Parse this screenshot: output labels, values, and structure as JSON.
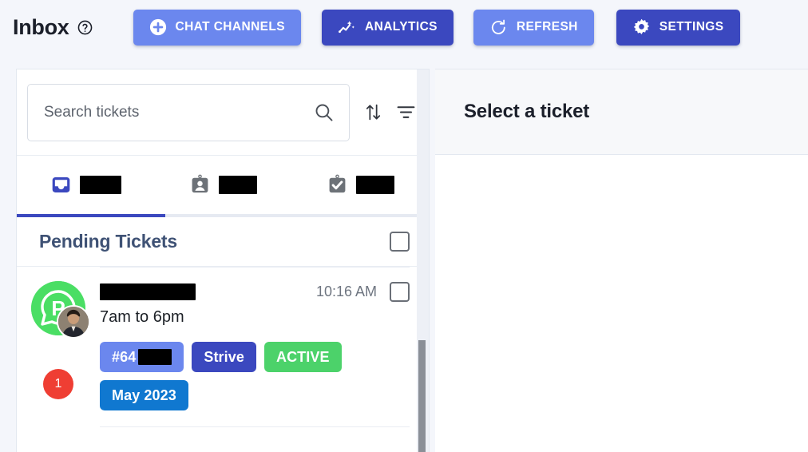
{
  "header": {
    "title": "Inbox",
    "help_icon": "help-circle-icon",
    "buttons": [
      {
        "id": "chat-channels",
        "label": "CHAT CHANNELS",
        "icon": "plus-circle-icon",
        "style": "light",
        "color": "#6b87ee"
      },
      {
        "id": "analytics",
        "label": "ANALYTICS",
        "icon": "analytics-sparkline-icon",
        "style": "dark",
        "color": "#3b48bf"
      },
      {
        "id": "refresh",
        "label": "REFRESH",
        "icon": "refresh-icon",
        "style": "light",
        "color": "#6b87ee"
      },
      {
        "id": "settings",
        "label": "SETTINGS",
        "icon": "gear-icon",
        "style": "dark",
        "color": "#3b48bf"
      }
    ]
  },
  "search": {
    "placeholder": "Search tickets",
    "value": "",
    "search_icon": "search-icon",
    "sort_icon": "sort-arrows-icon",
    "filter_icon": "filter-icon"
  },
  "tabs": {
    "active_index": 0,
    "items": [
      {
        "icon": "inbox-icon",
        "label": "",
        "redacted": true,
        "redact_width": 52,
        "active": true
      },
      {
        "icon": "contact-card-icon",
        "label": "",
        "redacted": true,
        "redact_width": 48,
        "active": false
      },
      {
        "icon": "clipboard-check-icon",
        "label": "",
        "redacted": true,
        "redact_width": 48,
        "active": false
      }
    ]
  },
  "list": {
    "section_title": "Pending Tickets",
    "select_all_checked": false,
    "tickets": [
      {
        "avatar_icon": "whatsapp-avatar-icon",
        "avatar_color": "#4ade64",
        "has_profile_photo": true,
        "unread_count": "1",
        "unread_color": "#ef3e33",
        "subject": "",
        "subject_redacted": true,
        "time": "10:16 AM",
        "selected": false,
        "detail": "7am to 6pm",
        "chips": [
          {
            "label": "#64",
            "redacted_suffix": true,
            "color": "#6b87ee",
            "name": "ticket-id"
          },
          {
            "label": "Strive",
            "redacted_suffix": false,
            "color": "#3b48bf",
            "name": "brand"
          },
          {
            "label": "ACTIVE",
            "redacted_suffix": false,
            "color": "#4cd26a",
            "name": "status"
          },
          {
            "label": "May 2023",
            "redacted_suffix": false,
            "color": "#1078d0",
            "name": "date"
          }
        ]
      }
    ]
  },
  "detail": {
    "empty_title": "Select a ticket"
  },
  "colors": {
    "page_background": "#f4f6fb",
    "panel_background": "#ffffff",
    "accent_light": "#6b87ee",
    "accent_dark": "#3b48bf",
    "success": "#4cd26a",
    "danger": "#ef3e33",
    "info": "#1078d0",
    "section_title": "#3f5275"
  }
}
